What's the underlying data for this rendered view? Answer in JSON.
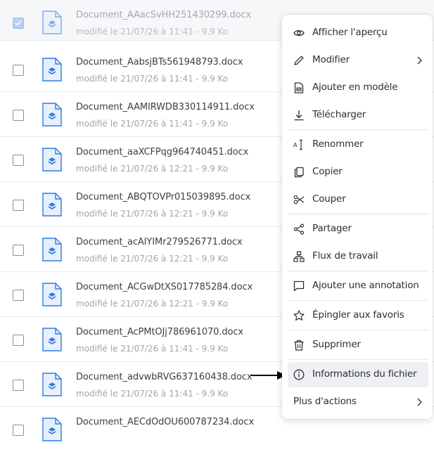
{
  "files": [
    {
      "name": "Document_AAacSvHH251430299.docx",
      "meta": "modifié le 21/07/26 à 11:41 - 9.9 Ko",
      "checked": true
    },
    {
      "name": "Document_AabsjBTs561948793.docx",
      "meta": "modifié le 21/07/26 à 11:41 - 9.9 Ko",
      "checked": false
    },
    {
      "name": "Document_AAMIRWDB330114911.docx",
      "meta": "modifié le 21/07/26 à 11:41 - 9.9 Ko",
      "checked": false
    },
    {
      "name": "Document_aaXCFPqg964740451.docx",
      "meta": "modifié le 21/07/26 à 12:21 - 9.9 Ko",
      "checked": false
    },
    {
      "name": "Document_ABQTOVPr015039895.docx",
      "meta": "modifié le 21/07/26 à 12:21 - 9.9 Ko",
      "checked": false
    },
    {
      "name": "Document_acAIYIMr279526771.docx",
      "meta": "modifié le 21/07/26 à 12:21 - 9.9 Ko",
      "checked": false
    },
    {
      "name": "Document_ACGwDtXS017785284.docx",
      "meta": "modifié le 21/07/26 à 12:21 - 9.9 Ko",
      "checked": false
    },
    {
      "name": "Document_AcPMtOJj786961070.docx",
      "meta": "modifié le 21/07/26 à 11:41 - 9.9 Ko",
      "checked": false
    },
    {
      "name": "Document_advwbRVG637160438.docx",
      "meta": "modifié le 21/07/26 à 11:41 - 9.9 Ko",
      "checked": false
    },
    {
      "name": "Document_AECdOdOU600787234.docx",
      "meta": "",
      "checked": false
    }
  ],
  "menu": {
    "items": [
      {
        "id": "preview",
        "label": "Afficher l'aperçu",
        "icon": "eye-icon"
      },
      {
        "id": "edit",
        "label": "Modifier",
        "icon": "pencil-icon",
        "submenu": true
      },
      {
        "id": "add-template",
        "label": "Ajouter en modèle",
        "icon": "template-icon"
      },
      {
        "id": "download",
        "label": "Télécharger",
        "icon": "download-icon"
      },
      {
        "id": "rename",
        "label": "Renommer",
        "icon": "rename-icon"
      },
      {
        "id": "copy",
        "label": "Copier",
        "icon": "copy-icon"
      },
      {
        "id": "cut",
        "label": "Couper",
        "icon": "scissors-icon"
      },
      {
        "id": "share",
        "label": "Partager",
        "icon": "share-icon"
      },
      {
        "id": "workflow",
        "label": "Flux de travail",
        "icon": "workflow-icon"
      },
      {
        "id": "annotate",
        "label": "Ajouter une annotation",
        "icon": "comment-icon"
      },
      {
        "id": "favorite",
        "label": "Épingler aux favoris",
        "icon": "star-icon"
      },
      {
        "id": "delete",
        "label": "Supprimer",
        "icon": "trash-icon"
      },
      {
        "id": "info",
        "label": "Informations du fichier",
        "icon": "info-icon",
        "hovered": true
      },
      {
        "id": "more",
        "label": "Plus d'actions",
        "submenu": true
      }
    ]
  },
  "colors": {
    "doc_icon_blue": "#2f7be5",
    "doc_icon_bg": "#e7f0fc",
    "hover": "#eef0f3"
  }
}
